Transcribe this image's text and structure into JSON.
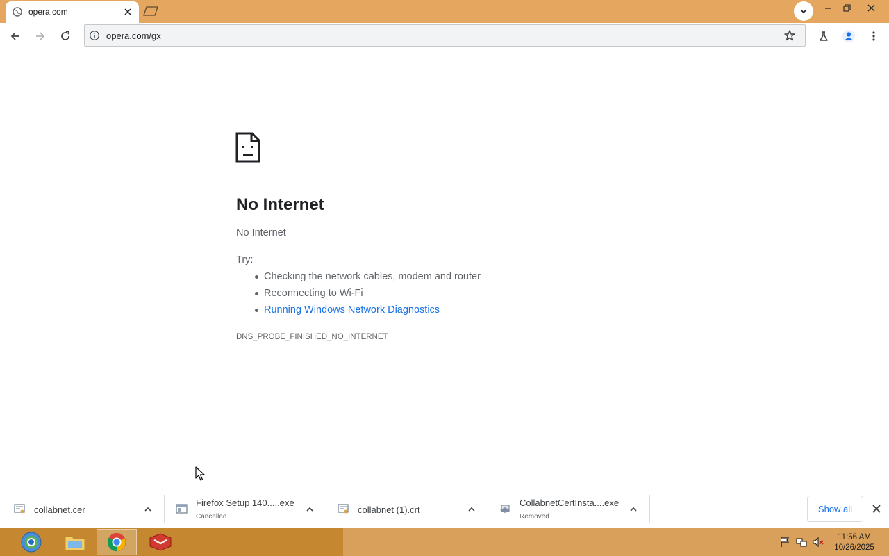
{
  "browser": {
    "tab": {
      "title": "opera.com"
    },
    "address_bar": {
      "url": "opera.com/gx"
    }
  },
  "error_page": {
    "title": "No Internet",
    "subtitle": "No Internet",
    "try_label": "Try:",
    "suggestions": [
      "Checking the network cables, modem and router",
      "Reconnecting to Wi-Fi",
      "Running Windows Network Diagnostics"
    ],
    "error_code": "DNS_PROBE_FINISHED_NO_INTERNET"
  },
  "downloads": {
    "items": [
      {
        "name": "collabnet.cer",
        "status": "",
        "icon": "certificate-file-icon"
      },
      {
        "name": "Firefox Setup 140.....exe",
        "status": "Cancelled",
        "icon": "installer-file-icon"
      },
      {
        "name": "collabnet (1).crt",
        "status": "",
        "icon": "certificate-file-icon"
      },
      {
        "name": "CollabnetCertInsta....exe",
        "status": "Removed",
        "icon": "installer-file-icon"
      }
    ],
    "show_all_label": "Show all"
  },
  "taskbar": {
    "apps": [
      "chrome-icon",
      "file-explorer-icon",
      "chrome-icon",
      "red-app-icon"
    ],
    "clock": {
      "time": "11:56 AM",
      "date": "10/26/2025"
    }
  },
  "colors": {
    "frame": "#e5a660",
    "taskbar": "#d9a05b",
    "link": "#1a73e8"
  }
}
